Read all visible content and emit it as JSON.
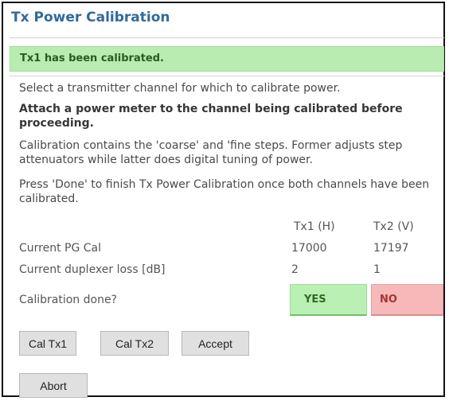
{
  "dialog": {
    "title": "Tx Power Calibration",
    "status_message": "Tx1 has been calibrated.",
    "instructions": [
      "Select a transmitter channel for which to calibrate power.",
      "Attach a power meter to the channel being calibrated before proceeding.",
      "Calibration contains the 'coarse' and 'fine steps. Former adjusts step attenuators while latter does digital tuning of power.",
      "Press 'Done' to finish Tx Power Calibration once both channels have been calibrated."
    ]
  },
  "table": {
    "columns": [
      "Tx1 (H)",
      "Tx2 (V)"
    ],
    "rows": [
      {
        "label": "Current PG Cal",
        "values": [
          "17000",
          "17197"
        ]
      },
      {
        "label": "Current duplexer loss [dB]",
        "values": [
          "2",
          "1"
        ]
      },
      {
        "label": "Calibration done?",
        "values": [
          "YES",
          "NO"
        ]
      }
    ]
  },
  "buttons": {
    "cal_tx1": "Cal Tx1",
    "cal_tx2": "Cal Tx2",
    "accept": "Accept",
    "abort": "Abort"
  },
  "colors": {
    "title": "#2f6a9c",
    "success_banner": "#b8ecb1",
    "yes_badge": "#baf0b4",
    "no_badge": "#f6b8b8"
  }
}
